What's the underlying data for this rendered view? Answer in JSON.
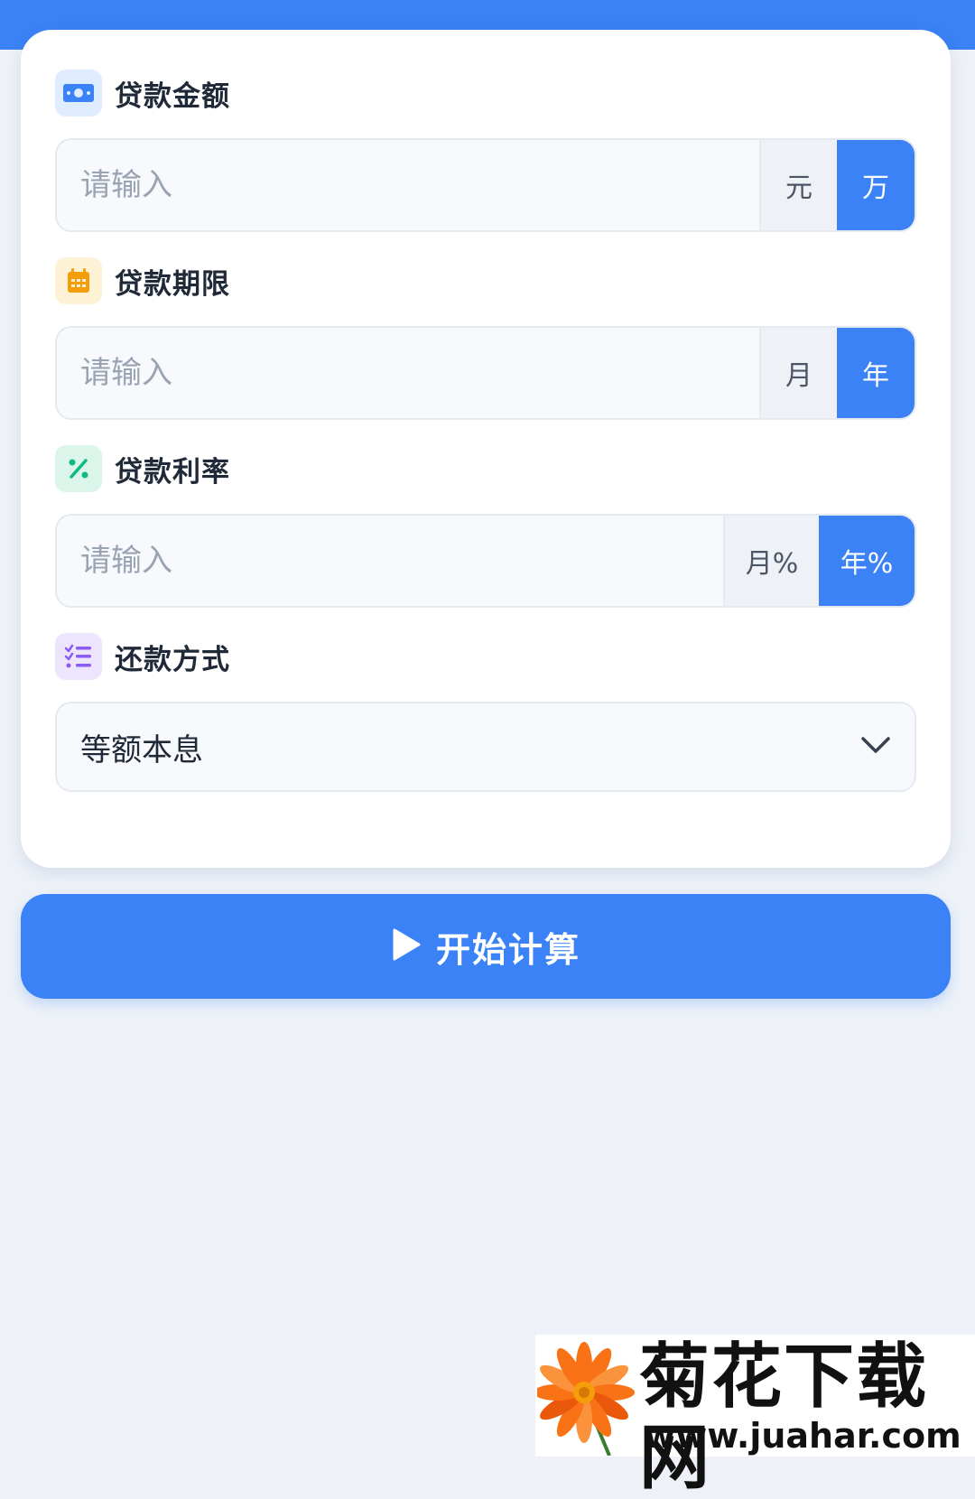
{
  "header": {
    "title": ""
  },
  "loan_amount": {
    "label": "贷款金额",
    "placeholder": "请输入",
    "unit_left": "元",
    "unit_right": "万",
    "selected_unit": "万",
    "icon": "money-icon",
    "icon_color": "#3b82f6"
  },
  "loan_term": {
    "label": "贷款期限",
    "placeholder": "请输入",
    "unit_left": "月",
    "unit_right": "年",
    "selected_unit": "年",
    "icon": "calendar-icon",
    "icon_color": "#f59e0b"
  },
  "loan_rate": {
    "label": "贷款利率",
    "placeholder": "请输入",
    "unit_left": "月%",
    "unit_right": "年%",
    "selected_unit": "年%",
    "icon": "percent-icon",
    "icon_color": "#10b981"
  },
  "repayment": {
    "label": "还款方式",
    "selected": "等额本息",
    "icon": "list-check-icon",
    "icon_color": "#8b5cf6"
  },
  "calculate_button": {
    "label": "开始计算",
    "icon": "play-icon"
  },
  "watermark": {
    "title": "菊花下载网",
    "url": "www.juahar.com"
  },
  "colors": {
    "accent": "#3b82f6",
    "background": "#eef2f8"
  }
}
